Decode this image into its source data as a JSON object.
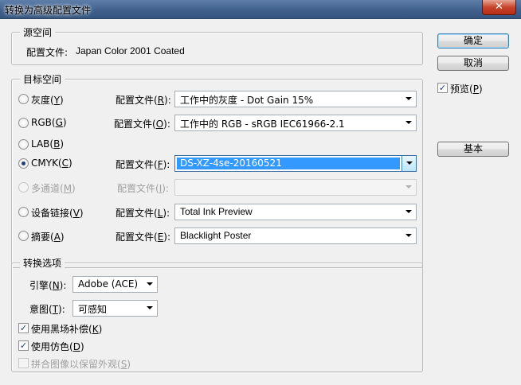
{
  "window": {
    "title": "转换为高级配置文件",
    "close_glyph": "✕"
  },
  "source_space": {
    "legend": "源空间",
    "profile_label": "配置文件:",
    "profile_value": "Japan Color 2001 Coated"
  },
  "target_space": {
    "legend": "目标空间",
    "rows": [
      {
        "radio_label": "灰度(",
        "key": "Y",
        "profile_label": "配置文件(",
        "profile_key": "R",
        "value": "工作中的灰度 - Dot Gain 15%"
      },
      {
        "radio_label": "RGB(",
        "key": "G",
        "profile_label": "配置文件(",
        "profile_key": "O",
        "value": "工作中的 RGB - sRGB IEC61966-2.1"
      },
      {
        "radio_label": "LAB(",
        "key": "B"
      },
      {
        "radio_label": "CMYK(",
        "key": "C",
        "profile_label": "配置文件(",
        "profile_key": "F",
        "value": "DS-XZ-4se-20160521"
      },
      {
        "radio_label": "多通道(",
        "key": "M",
        "profile_label": "配置文件(",
        "profile_key": "I",
        "value": ""
      },
      {
        "radio_label": "设备链接(",
        "key": "V",
        "profile_label": "配置文件(",
        "profile_key": "L",
        "value": "Total Ink Preview"
      },
      {
        "radio_label": "摘要(",
        "key": "A",
        "profile_label": "配置文件(",
        "profile_key": "E",
        "value": "Blacklight Poster"
      }
    ],
    "close_paren": ")",
    "close_paren_colon": "):"
  },
  "conversion_options": {
    "legend": "转换选项",
    "engine_label": "引擎(",
    "engine_key": "N",
    "engine_value": "Adobe (ACE)",
    "intent_label": "意图(",
    "intent_key": "T",
    "intent_value": "可感知",
    "bpc_label": "使用黑场补偿(",
    "bpc_key": "K",
    "dither_label": "使用仿色(",
    "dither_key": "D",
    "flatten_label": "拼合图像以保留外观(",
    "flatten_key": "S"
  },
  "buttons": {
    "ok": "确定",
    "cancel": "取消",
    "basic": "基本"
  },
  "preview": {
    "label": "预览(",
    "key": "P"
  },
  "check_glyph": "✓",
  "colors": {
    "selection": "#3399ff",
    "title_bar": "#3f5f8a",
    "close": "#c7452c"
  }
}
